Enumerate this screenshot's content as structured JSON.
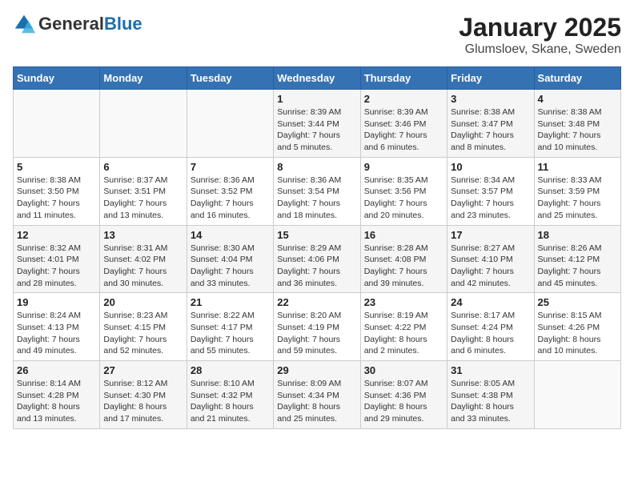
{
  "logo": {
    "general": "General",
    "blue": "Blue"
  },
  "title": "January 2025",
  "subtitle": "Glumsloev, Skane, Sweden",
  "days_of_week": [
    "Sunday",
    "Monday",
    "Tuesday",
    "Wednesday",
    "Thursday",
    "Friday",
    "Saturday"
  ],
  "weeks": [
    [
      {
        "day": "",
        "info": ""
      },
      {
        "day": "",
        "info": ""
      },
      {
        "day": "",
        "info": ""
      },
      {
        "day": "1",
        "info": "Sunrise: 8:39 AM\nSunset: 3:44 PM\nDaylight: 7 hours\nand 5 minutes."
      },
      {
        "day": "2",
        "info": "Sunrise: 8:39 AM\nSunset: 3:46 PM\nDaylight: 7 hours\nand 6 minutes."
      },
      {
        "day": "3",
        "info": "Sunrise: 8:38 AM\nSunset: 3:47 PM\nDaylight: 7 hours\nand 8 minutes."
      },
      {
        "day": "4",
        "info": "Sunrise: 8:38 AM\nSunset: 3:48 PM\nDaylight: 7 hours\nand 10 minutes."
      }
    ],
    [
      {
        "day": "5",
        "info": "Sunrise: 8:38 AM\nSunset: 3:50 PM\nDaylight: 7 hours\nand 11 minutes."
      },
      {
        "day": "6",
        "info": "Sunrise: 8:37 AM\nSunset: 3:51 PM\nDaylight: 7 hours\nand 13 minutes."
      },
      {
        "day": "7",
        "info": "Sunrise: 8:36 AM\nSunset: 3:52 PM\nDaylight: 7 hours\nand 16 minutes."
      },
      {
        "day": "8",
        "info": "Sunrise: 8:36 AM\nSunset: 3:54 PM\nDaylight: 7 hours\nand 18 minutes."
      },
      {
        "day": "9",
        "info": "Sunrise: 8:35 AM\nSunset: 3:56 PM\nDaylight: 7 hours\nand 20 minutes."
      },
      {
        "day": "10",
        "info": "Sunrise: 8:34 AM\nSunset: 3:57 PM\nDaylight: 7 hours\nand 23 minutes."
      },
      {
        "day": "11",
        "info": "Sunrise: 8:33 AM\nSunset: 3:59 PM\nDaylight: 7 hours\nand 25 minutes."
      }
    ],
    [
      {
        "day": "12",
        "info": "Sunrise: 8:32 AM\nSunset: 4:01 PM\nDaylight: 7 hours\nand 28 minutes."
      },
      {
        "day": "13",
        "info": "Sunrise: 8:31 AM\nSunset: 4:02 PM\nDaylight: 7 hours\nand 30 minutes."
      },
      {
        "day": "14",
        "info": "Sunrise: 8:30 AM\nSunset: 4:04 PM\nDaylight: 7 hours\nand 33 minutes."
      },
      {
        "day": "15",
        "info": "Sunrise: 8:29 AM\nSunset: 4:06 PM\nDaylight: 7 hours\nand 36 minutes."
      },
      {
        "day": "16",
        "info": "Sunrise: 8:28 AM\nSunset: 4:08 PM\nDaylight: 7 hours\nand 39 minutes."
      },
      {
        "day": "17",
        "info": "Sunrise: 8:27 AM\nSunset: 4:10 PM\nDaylight: 7 hours\nand 42 minutes."
      },
      {
        "day": "18",
        "info": "Sunrise: 8:26 AM\nSunset: 4:12 PM\nDaylight: 7 hours\nand 45 minutes."
      }
    ],
    [
      {
        "day": "19",
        "info": "Sunrise: 8:24 AM\nSunset: 4:13 PM\nDaylight: 7 hours\nand 49 minutes."
      },
      {
        "day": "20",
        "info": "Sunrise: 8:23 AM\nSunset: 4:15 PM\nDaylight: 7 hours\nand 52 minutes."
      },
      {
        "day": "21",
        "info": "Sunrise: 8:22 AM\nSunset: 4:17 PM\nDaylight: 7 hours\nand 55 minutes."
      },
      {
        "day": "22",
        "info": "Sunrise: 8:20 AM\nSunset: 4:19 PM\nDaylight: 7 hours\nand 59 minutes."
      },
      {
        "day": "23",
        "info": "Sunrise: 8:19 AM\nSunset: 4:22 PM\nDaylight: 8 hours\nand 2 minutes."
      },
      {
        "day": "24",
        "info": "Sunrise: 8:17 AM\nSunset: 4:24 PM\nDaylight: 8 hours\nand 6 minutes."
      },
      {
        "day": "25",
        "info": "Sunrise: 8:15 AM\nSunset: 4:26 PM\nDaylight: 8 hours\nand 10 minutes."
      }
    ],
    [
      {
        "day": "26",
        "info": "Sunrise: 8:14 AM\nSunset: 4:28 PM\nDaylight: 8 hours\nand 13 minutes."
      },
      {
        "day": "27",
        "info": "Sunrise: 8:12 AM\nSunset: 4:30 PM\nDaylight: 8 hours\nand 17 minutes."
      },
      {
        "day": "28",
        "info": "Sunrise: 8:10 AM\nSunset: 4:32 PM\nDaylight: 8 hours\nand 21 minutes."
      },
      {
        "day": "29",
        "info": "Sunrise: 8:09 AM\nSunset: 4:34 PM\nDaylight: 8 hours\nand 25 minutes."
      },
      {
        "day": "30",
        "info": "Sunrise: 8:07 AM\nSunset: 4:36 PM\nDaylight: 8 hours\nand 29 minutes."
      },
      {
        "day": "31",
        "info": "Sunrise: 8:05 AM\nSunset: 4:38 PM\nDaylight: 8 hours\nand 33 minutes."
      },
      {
        "day": "",
        "info": ""
      }
    ]
  ]
}
